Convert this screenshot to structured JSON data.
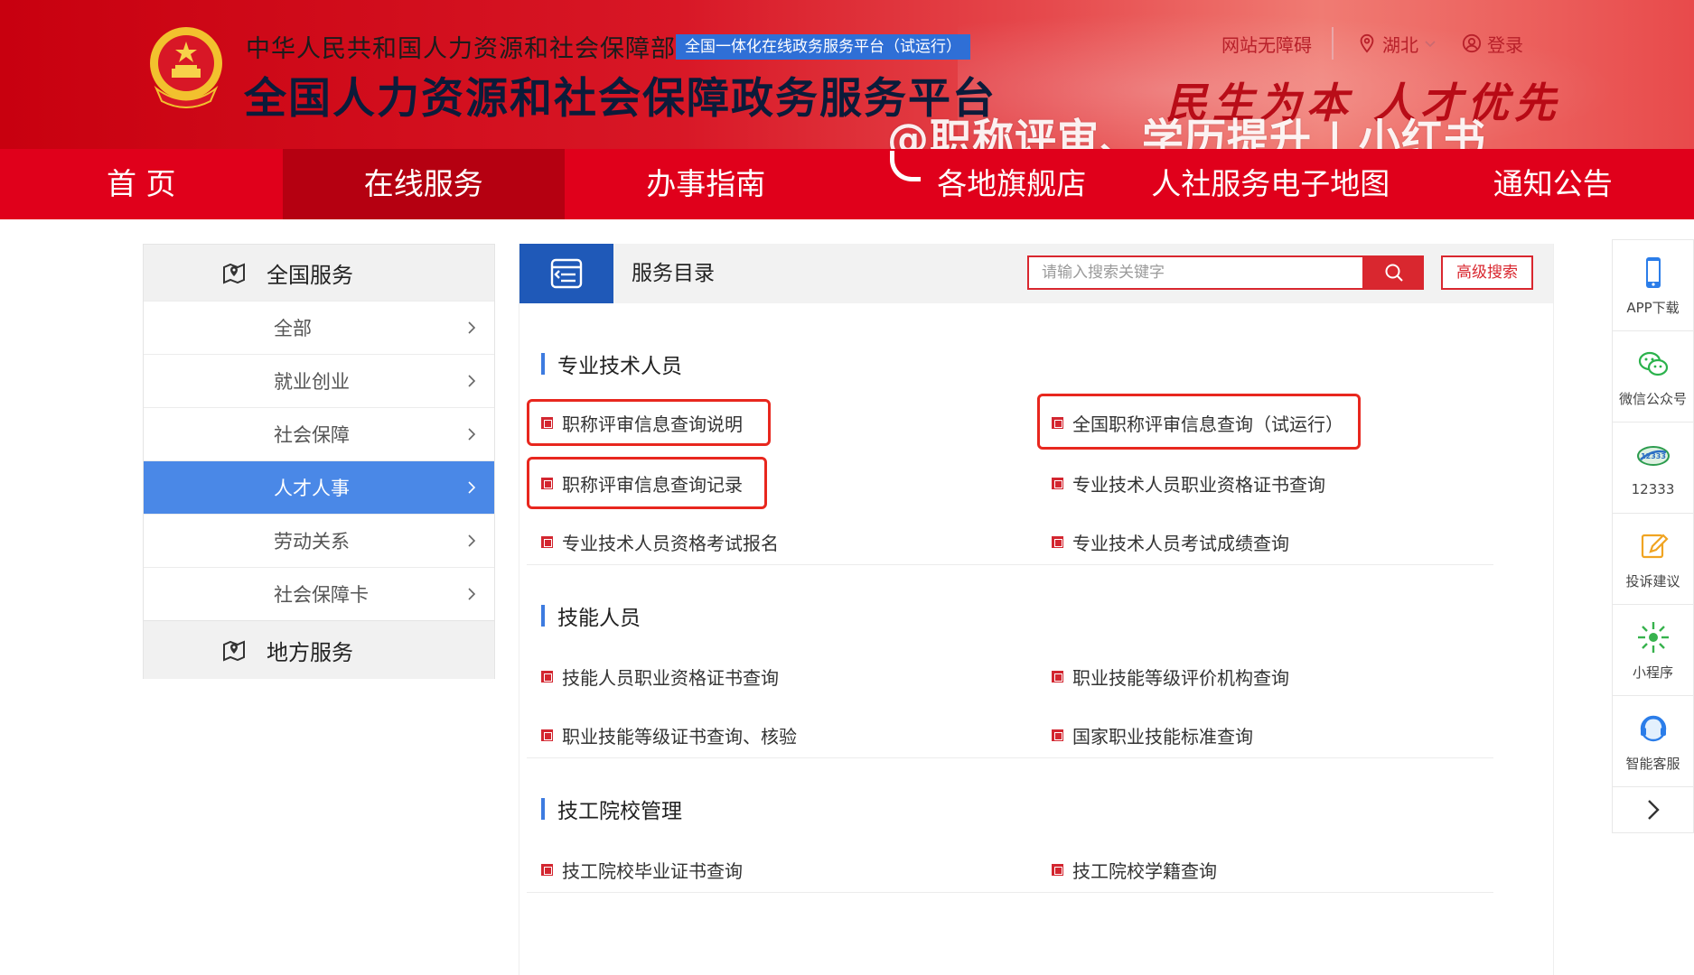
{
  "header": {
    "ministry_name": "中华人民共和国人力资源和社会保障部",
    "platform_badge": "全国一体化在线政务服务平台（试运行）",
    "site_title": "全国人力资源和社会保障政务服务平台",
    "slogan": "民生为本 人才优先",
    "accessibility_link": "网站无障碍",
    "location": "湖北",
    "login": "登录",
    "watermark": "@职称评审、学历提升 | 小红书"
  },
  "nav": {
    "items": [
      "首 页",
      "在线服务",
      "办事指南",
      "各地旗舰店",
      "人社服务电子地图",
      "通知公告"
    ],
    "active_index": 1
  },
  "sidebar": {
    "national_title": "全国服务",
    "items": [
      "全部",
      "就业创业",
      "社会保障",
      "人才人事",
      "劳动关系",
      "社会保障卡"
    ],
    "active_index": 3,
    "local_title": "地方服务"
  },
  "main": {
    "title": "服务目录",
    "search_placeholder": "请输入搜索关键字",
    "advanced_search": "高级搜索",
    "sections": [
      {
        "title": "专业技术人员",
        "links": [
          "职称评审信息查询说明",
          "全国职称评审信息查询（试运行）",
          "职称评审信息查询记录",
          "专业技术人员职业资格证书查询",
          "专业技术人员资格考试报名",
          "专业技术人员考试成绩查询"
        ]
      },
      {
        "title": "技能人员",
        "links": [
          "技能人员职业资格证书查询",
          "职业技能等级评价机构查询",
          "职业技能等级证书查询、核验",
          "国家职业技能标准查询"
        ]
      },
      {
        "title": "技工院校管理",
        "links": [
          "技工院校毕业证书查询",
          "技工院校学籍查询"
        ]
      }
    ]
  },
  "rail": {
    "items": [
      "APP下载",
      "微信公众号",
      "12333",
      "投诉建议",
      "小程序",
      "智能客服"
    ]
  },
  "colors": {
    "brand_red": "#e0001b",
    "active_nav": "#b50011",
    "sidebar_active": "#4a88e7",
    "catalog_icon_bg": "#1f59b8",
    "highlight_box": "#e8271e"
  }
}
